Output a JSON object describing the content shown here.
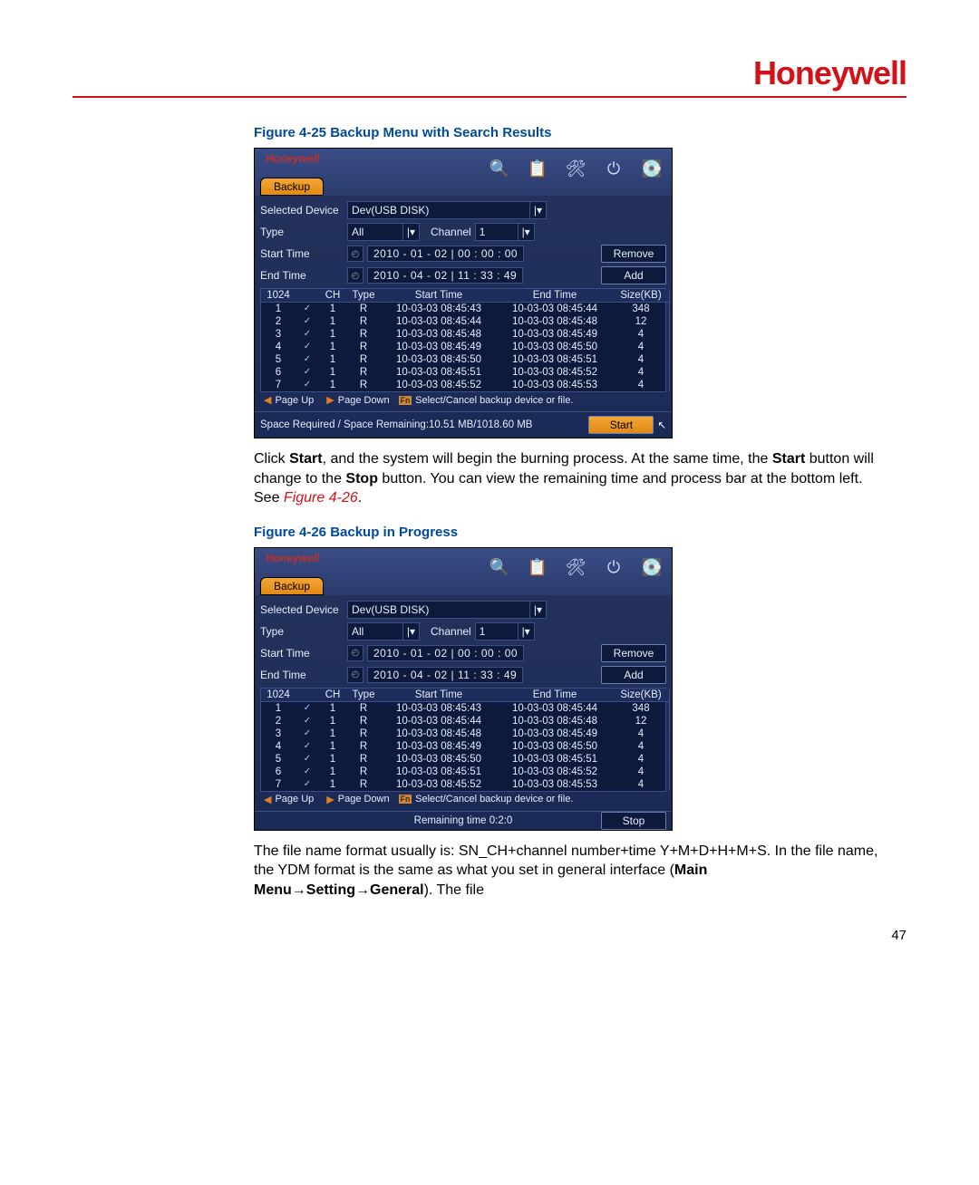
{
  "brand": "Honeywell",
  "page_number": "47",
  "figure1_caption": "Figure 4-25 Backup Menu with Search Results",
  "figure2_caption": "Figure 4-26 Backup in Progress",
  "para1_a": "Click ",
  "para1_b": "Start",
  "para1_c": ", and the system will begin the burning process. At the same time, the ",
  "para1_d": "Start",
  "para1_e": " button will change to the ",
  "para1_f": "Stop",
  "para1_g": " button. You can view the remaining time and process bar at the bottom left. See ",
  "para1_link": "Figure 4-26",
  "para1_h": ".",
  "para2_a": "The file name format usually is: SN_CH+channel number+time Y+M+D+H+M+S. In the file name, the YDM format is the same as what you set in general interface (",
  "para2_b": "Main Menu→Setting→General",
  "para2_c": "). The file",
  "panel1": {
    "tab": "Backup",
    "labels": {
      "device": "Selected Device",
      "type": "Type",
      "channel": "Channel",
      "start": "Start Time",
      "end": "End Time"
    },
    "device_value": "Dev(USB DISK)",
    "type_value": "All",
    "channel_value": "1",
    "start_value": "2010  - 01 - 02  | 00 : 00 : 00",
    "end_value": "2010  - 04 - 02  | 11 : 33 : 49",
    "btn_remove": "Remove",
    "btn_add": "Add",
    "total_hdr": "1024",
    "cols": {
      "ch": "CH",
      "type": "Type",
      "start": "Start Time",
      "end": "End Time",
      "size": "Size(KB)"
    },
    "rows": [
      {
        "n": "1",
        "ch": "1",
        "t": "R",
        "s": "10-03-03 08:45:43",
        "e": "10-03-03 08:45:44",
        "sz": "348"
      },
      {
        "n": "2",
        "ch": "1",
        "t": "R",
        "s": "10-03-03 08:45:44",
        "e": "10-03-03 08:45:48",
        "sz": "12"
      },
      {
        "n": "3",
        "ch": "1",
        "t": "R",
        "s": "10-03-03 08:45:48",
        "e": "10-03-03 08:45:49",
        "sz": "4"
      },
      {
        "n": "4",
        "ch": "1",
        "t": "R",
        "s": "10-03-03 08:45:49",
        "e": "10-03-03 08:45:50",
        "sz": "4"
      },
      {
        "n": "5",
        "ch": "1",
        "t": "R",
        "s": "10-03-03 08:45:50",
        "e": "10-03-03 08:45:51",
        "sz": "4"
      },
      {
        "n": "6",
        "ch": "1",
        "t": "R",
        "s": "10-03-03 08:45:51",
        "e": "10-03-03 08:45:52",
        "sz": "4"
      },
      {
        "n": "7",
        "ch": "1",
        "t": "R",
        "s": "10-03-03 08:45:52",
        "e": "10-03-03 08:45:53",
        "sz": "4"
      }
    ],
    "page_up": "Page Up",
    "page_down": "Page Down",
    "fn_hint": "Select/Cancel backup device or file.",
    "fn_label": "Fn",
    "space_text": "Space Required / Space Remaining:10.51 MB/1018.60 MB",
    "btn_action": "Start"
  },
  "panel2": {
    "tab": "Backup",
    "labels": {
      "device": "Selected Device",
      "type": "Type",
      "channel": "Channel",
      "start": "Start Time",
      "end": "End Time"
    },
    "device_value": "Dev(USB DISK)",
    "type_value": "All",
    "channel_value": "1",
    "start_value": "2010  - 01 - 02  | 00 : 00 : 00",
    "end_value": "2010  - 04 - 02  | 11 : 33 : 49",
    "btn_remove": "Remove",
    "btn_add": "Add",
    "total_hdr": "1024",
    "cols": {
      "ch": "CH",
      "type": "Type",
      "start": "Start Time",
      "end": "End Time",
      "size": "Size(KB)"
    },
    "rows": [
      {
        "n": "1",
        "ch": "1",
        "t": "R",
        "s": "10-03-03 08:45:43",
        "e": "10-03-03 08:45:44",
        "sz": "348"
      },
      {
        "n": "2",
        "ch": "1",
        "t": "R",
        "s": "10-03-03 08:45:44",
        "e": "10-03-03 08:45:48",
        "sz": "12"
      },
      {
        "n": "3",
        "ch": "1",
        "t": "R",
        "s": "10-03-03 08:45:48",
        "e": "10-03-03 08:45:49",
        "sz": "4"
      },
      {
        "n": "4",
        "ch": "1",
        "t": "R",
        "s": "10-03-03 08:45:49",
        "e": "10-03-03 08:45:50",
        "sz": "4"
      },
      {
        "n": "5",
        "ch": "1",
        "t": "R",
        "s": "10-03-03 08:45:50",
        "e": "10-03-03 08:45:51",
        "sz": "4"
      },
      {
        "n": "6",
        "ch": "1",
        "t": "R",
        "s": "10-03-03 08:45:51",
        "e": "10-03-03 08:45:52",
        "sz": "4"
      },
      {
        "n": "7",
        "ch": "1",
        "t": "R",
        "s": "10-03-03 08:45:52",
        "e": "10-03-03 08:45:53",
        "sz": "4"
      }
    ],
    "page_up": "Page Up",
    "page_down": "Page Down",
    "fn_hint": "Select/Cancel backup device or file.",
    "fn_label": "Fn",
    "remaining_text": "Remaining time 0:2:0",
    "btn_action": "Stop"
  }
}
